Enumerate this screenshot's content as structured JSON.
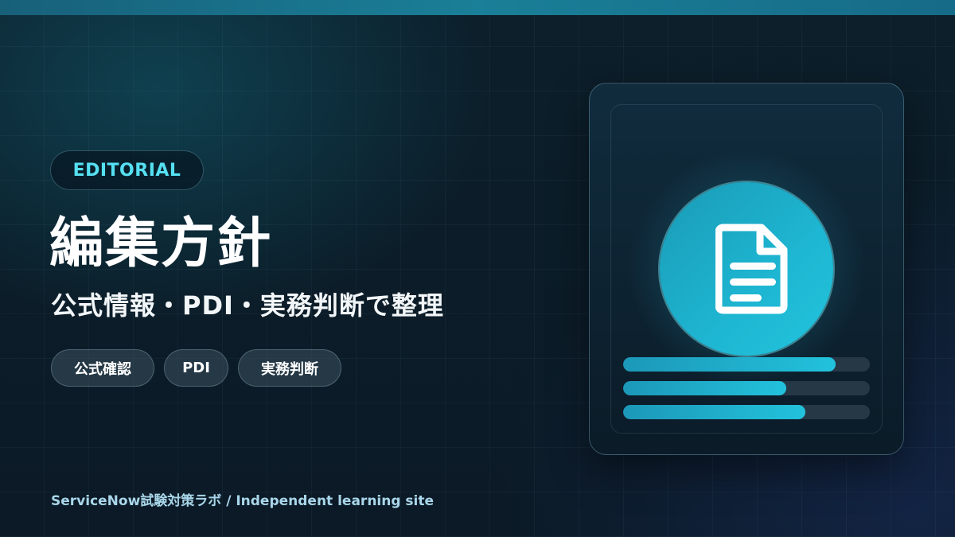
{
  "tag": "EDITORIAL",
  "title": "編集方針",
  "subtitle": "公式情報・PDI・実務判断で整理",
  "chips": [
    "公式確認",
    "PDI",
    "実務判断"
  ],
  "footer": "ServiceNow試験対策ラボ / Independent learning site",
  "illustration": {
    "icon": "document-icon",
    "accent_color": "#1fb8d4",
    "progress_levels": [
      0.86,
      0.66,
      0.74
    ]
  }
}
